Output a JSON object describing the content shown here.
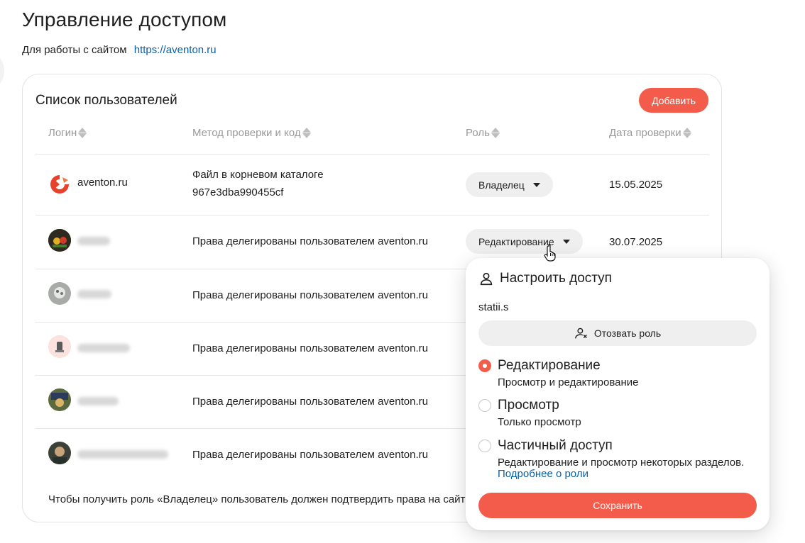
{
  "page": {
    "title": "Управление доступом",
    "site_prefix": "Для работы с сайтом",
    "site_url": "https://aventon.ru"
  },
  "users_card": {
    "title": "Список пользователей",
    "add_label": "Добавить",
    "columns": [
      "Логин",
      "Метод проверки и код",
      "Роль",
      "Дата проверки"
    ],
    "rows": [
      {
        "login": "aventon.ru",
        "method": "Файл в корневом каталоге",
        "code": "967e3dba990455cf",
        "role": "Владелец",
        "date": "15.05.2025"
      },
      {
        "login": "",
        "method": "Права делегированы пользователем aventon.ru",
        "role": "Редактирование",
        "date": "30.07.2025"
      },
      {
        "login": "",
        "method": "Права делегированы пользователем aventon.ru"
      },
      {
        "login": "",
        "method": "Права делегированы пользователем aventon.ru"
      },
      {
        "login": "",
        "method": "Права делегированы пользователем aventon.ru"
      },
      {
        "login": "",
        "method": "Права делегированы пользователем aventon.ru"
      }
    ],
    "footnote": "Чтобы получить роль «Владелец» пользователь должен подтвердить права на сайт"
  },
  "access_popup": {
    "title": "Настроить доступ",
    "username": "statii.s",
    "revoke_label": "Отозвать роль",
    "options": [
      {
        "title": "Редактирование",
        "desc": "Просмотр и редактирование",
        "selected": true
      },
      {
        "title": "Просмотр",
        "desc": "Только просмотр",
        "selected": false
      },
      {
        "title": "Частичный доступ",
        "desc": "Редактирование и просмотр некоторых разделов.",
        "link": "Подробнее о роли",
        "selected": false
      }
    ],
    "save_label": "Сохранить"
  },
  "colors": {
    "accent": "#f35b4a",
    "link": "#0b5fa5",
    "pill": "#efefef",
    "muted_header": "#9a9a9a"
  }
}
